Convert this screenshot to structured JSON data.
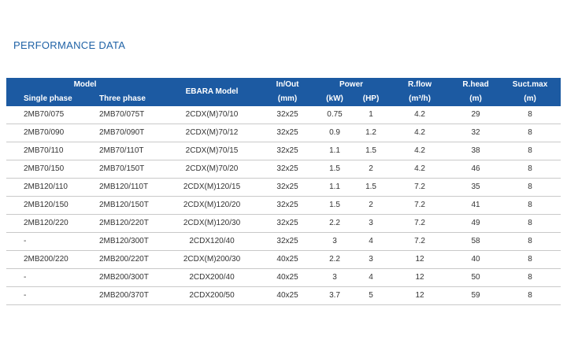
{
  "title": "PERFORMANCE DATA",
  "header": {
    "model": "Model",
    "single_phase": "Single phase",
    "three_phase": "Three  phase",
    "ebara_model": "EBARA Model",
    "in_out": "In/Out",
    "in_out_unit": "(mm)",
    "power": "Power",
    "power_kw": "(kW)",
    "power_hp": "(HP)",
    "rflow": "R.flow",
    "rflow_unit": "(m³/h)",
    "rhead": "R.head",
    "rhead_unit": "(m)",
    "suct": "Suct.max",
    "suct_unit": "(m)"
  },
  "rows": [
    [
      "2MB70/075",
      "2MB70/075T",
      "2CDX(M)70/10",
      "32x25",
      "0.75",
      "1",
      "4.2",
      "29",
      "8"
    ],
    [
      "2MB70/090",
      "2MB70/090T",
      "2CDX(M)70/12",
      "32x25",
      "0.9",
      "1.2",
      "4.2",
      "32",
      "8"
    ],
    [
      "2MB70/110",
      "2MB70/110T",
      "2CDX(M)70/15",
      "32x25",
      "1.1",
      "1.5",
      "4.2",
      "38",
      "8"
    ],
    [
      "2MB70/150",
      "2MB70/150T",
      "2CDX(M)70/20",
      "32x25",
      "1.5",
      "2",
      "4.2",
      "46",
      "8"
    ],
    [
      "2MB120/110",
      "2MB120/110T",
      "2CDX(M)120/15",
      "32x25",
      "1.1",
      "1.5",
      "7.2",
      "35",
      "8"
    ],
    [
      "2MB120/150",
      "2MB120/150T",
      "2CDX(M)120/20",
      "32x25",
      "1.5",
      "2",
      "7.2",
      "41",
      "8"
    ],
    [
      "2MB120/220",
      "2MB120/220T",
      "2CDX(M)120/30",
      "32x25",
      "2.2",
      "3",
      "7.2",
      "49",
      "8"
    ],
    [
      "-",
      "2MB120/300T",
      "2CDX120/40",
      "32x25",
      "3",
      "4",
      "7.2",
      "58",
      "8"
    ],
    [
      "2MB200/220",
      "2MB200/220T",
      "2CDX(M)200/30",
      "40x25",
      "2.2",
      "3",
      "12",
      "40",
      "8"
    ],
    [
      "-",
      "2MB200/300T",
      "2CDX200/40",
      "40x25",
      "3",
      "4",
      "12",
      "50",
      "8"
    ],
    [
      "-",
      "2MB200/370T",
      "2CDX200/50",
      "40x25",
      "3.7",
      "5",
      "12",
      "59",
      "8"
    ]
  ]
}
